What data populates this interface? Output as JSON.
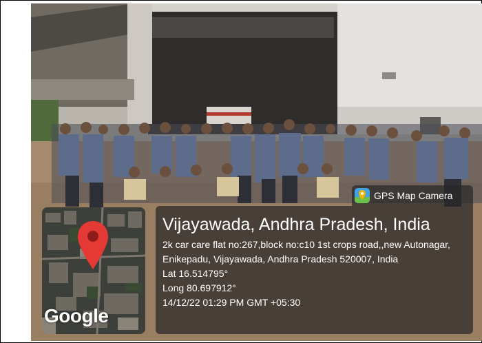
{
  "badge": {
    "label": "GPS Map Camera",
    "icon": "map-pin-icon",
    "color": "#3fa3e8"
  },
  "location": {
    "title": "Vijayawada, Andhra Pradesh, India",
    "address": "2k car care flat no:267,block no:c10 1st crops road,,new Autonagar, Enikepadu, Vijayawada, Andhra Pradesh 520007, India",
    "lat": "Lat 16.514795°",
    "long": "Long 80.697912°",
    "timestamp": "14/12/22 01:29 PM GMT +05:30"
  },
  "map": {
    "brand": "Google",
    "pin_color": "#e53935"
  }
}
